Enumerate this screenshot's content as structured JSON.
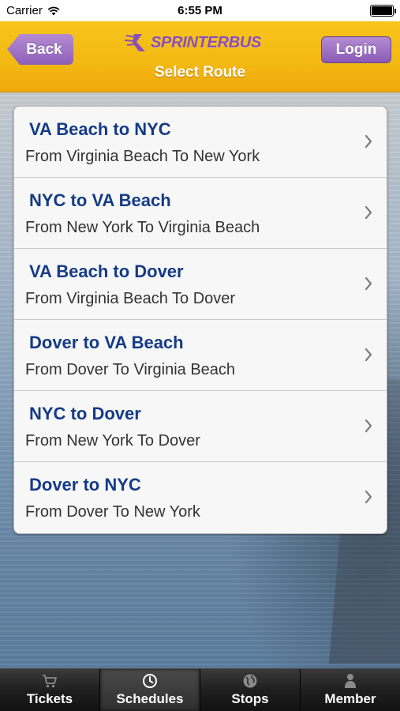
{
  "status_bar": {
    "carrier": "Carrier",
    "time": "6:55 PM"
  },
  "nav": {
    "back_label": "Back",
    "login_label": "Login",
    "logo_text": "SPRINTERBUS",
    "title": "Select Route"
  },
  "routes": [
    {
      "title": "VA Beach to NYC",
      "subtitle": "From Virginia Beach To New York"
    },
    {
      "title": "NYC to VA Beach",
      "subtitle": "From New York To Virginia Beach"
    },
    {
      "title": "VA Beach to Dover",
      "subtitle": "From Virginia Beach To Dover"
    },
    {
      "title": "Dover to VA Beach",
      "subtitle": "From Dover To Virginia Beach"
    },
    {
      "title": "NYC to Dover",
      "subtitle": "From New York To Dover"
    },
    {
      "title": "Dover to NYC",
      "subtitle": "From Dover To New York"
    }
  ],
  "tabs": [
    {
      "label": "Tickets",
      "icon": "cart-icon",
      "active": false
    },
    {
      "label": "Schedules",
      "icon": "clock-icon",
      "active": true
    },
    {
      "label": "Stops",
      "icon": "globe-icon",
      "active": false
    },
    {
      "label": "Member",
      "icon": "person-icon",
      "active": false
    }
  ],
  "colors": {
    "nav_bar": "#f3b812",
    "button_purple": "#8f5fb8",
    "route_title": "#143b86",
    "tab_bar": "#1f1f1f"
  }
}
